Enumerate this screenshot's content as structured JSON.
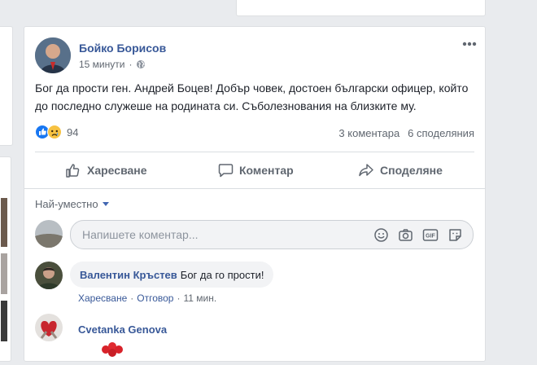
{
  "post": {
    "author": "Бойко Борисов",
    "time": "15 минути",
    "privacy_icon": "globe-icon",
    "options_icon": "ellipsis-icon",
    "text": "Бог да прости ген. Андрей Боцев! Добър човек, достоен български офицер, който до последно служеше на родината си. Съболезнования на близките му.",
    "reaction_icons": [
      "like-reaction-icon",
      "sad-reaction-icon"
    ],
    "reaction_count": "94",
    "comments_count": "3 коментара",
    "shares_count": "6 споделяния",
    "actions": {
      "like": "Харесване",
      "comment": "Коментар",
      "share": "Споделяне"
    }
  },
  "comments_section": {
    "sort_label": "Най-уместно",
    "input_placeholder": "Напишете коментар...",
    "input_icons": [
      "emoji-icon",
      "camera-icon",
      "gif-icon",
      "sticker-icon"
    ],
    "comments": [
      {
        "author": "Валентин Кръстев",
        "text": "Бог да го прости!",
        "like": "Харесване",
        "reply": "Отговор",
        "time": "11 мин."
      },
      {
        "author": "Cvetanka Genova"
      }
    ]
  },
  "colors": {
    "link": "#385898",
    "like_blue": "#1877f2",
    "background": "#e9ebee"
  }
}
